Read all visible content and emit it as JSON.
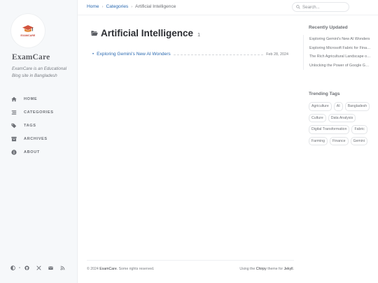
{
  "sidebar": {
    "logo_text": "EXAMCARE",
    "title": "ExamCare",
    "subtitle": "ExamCare is an Educational Blog site in Bangladesh",
    "nav": [
      {
        "label": "HOME",
        "icon": "home-icon"
      },
      {
        "label": "CATEGORIES",
        "icon": "stream-icon"
      },
      {
        "label": "TAGS",
        "icon": "tags-icon"
      },
      {
        "label": "ARCHIVES",
        "icon": "archive-icon"
      },
      {
        "label": "ABOUT",
        "icon": "info-icon"
      }
    ],
    "bottom_icons": [
      "theme-toggle-icon",
      "github-icon",
      "twitter-icon",
      "email-icon",
      "rss-icon"
    ]
  },
  "topbar": {
    "breadcrumb": [
      "Home",
      "Categories",
      "Artificial Intelligence"
    ],
    "search_placeholder": "Search..."
  },
  "main": {
    "title": "Artificial Intelligence",
    "count": "1",
    "posts": [
      {
        "title": "Exploring Gemini's New AI Wonders",
        "date": "Feb 28, 2024"
      }
    ]
  },
  "panel": {
    "recent_title": "Recently Updated",
    "recent": [
      "Exploring Gemini's New AI Wonders",
      "Exploring Microsoft Fabric for Financial Data",
      "The Rich Agricultural Landscape of Bangladesh",
      "Unlocking the Power of Google Gemini"
    ],
    "trending_title": "Trending Tags",
    "tags": [
      "Agriculture",
      "AI",
      "Bangladesh",
      "Culture",
      "Data Analysis",
      "Digital Transformation",
      "Fabric",
      "Farming",
      "Finance",
      "Gemini"
    ]
  },
  "footer": {
    "copyright_prefix": "© 2024",
    "owner": "ExamCare",
    "rights": ". Some rights reserved.",
    "theme_prefix": "Using the",
    "theme_name": "Chirpy",
    "theme_mid": "theme for",
    "engine": "Jekyll",
    "end": "."
  },
  "colors": {
    "accent": "#2a69b0",
    "sidebar_bg": "#f6f8fa",
    "logo_red": "#c0392b"
  }
}
